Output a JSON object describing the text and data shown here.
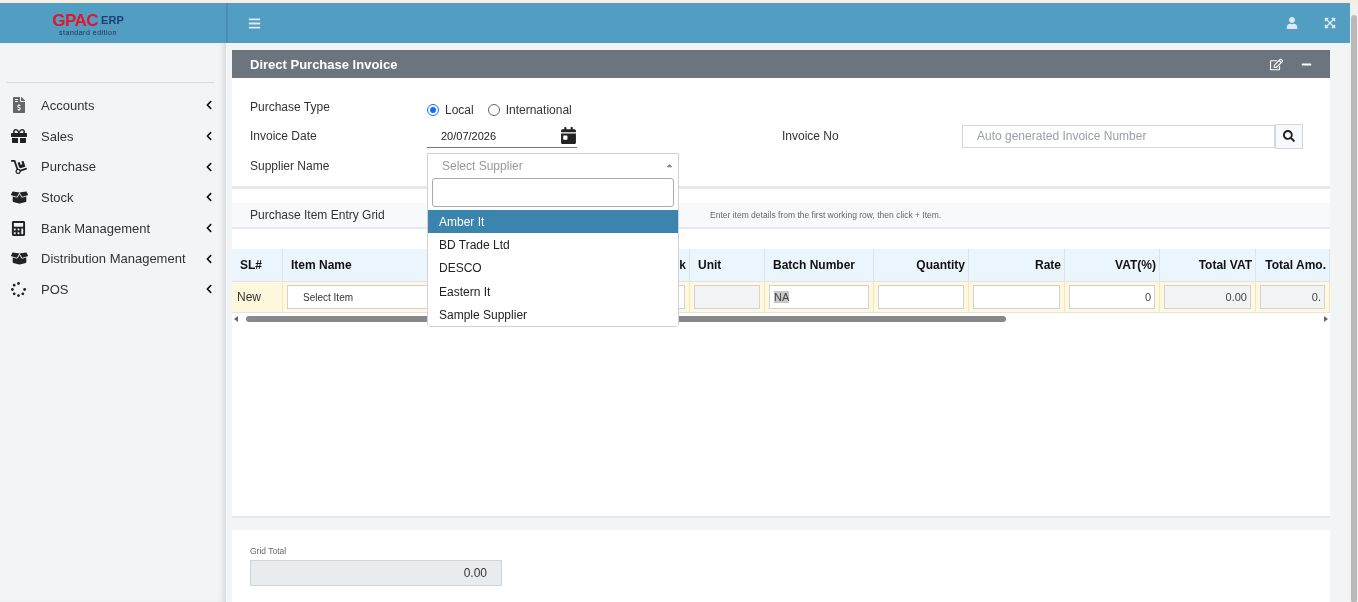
{
  "logo": {
    "brand": "GPAC",
    "suffix": "ERP",
    "edition": "standard edition"
  },
  "sidebar": {
    "items": [
      {
        "label": "Accounts",
        "kind": "accounts"
      },
      {
        "label": "Sales",
        "kind": "gift"
      },
      {
        "label": "Purchase",
        "kind": "cart"
      },
      {
        "label": "Stock",
        "kind": "box"
      },
      {
        "label": "Bank Management",
        "kind": "calculator"
      },
      {
        "label": "Distribution Management",
        "kind": "box"
      },
      {
        "label": "POS",
        "kind": "spinner"
      }
    ]
  },
  "panel": {
    "title": "Direct Purchase Invoice"
  },
  "form": {
    "purchase_type": {
      "label": "Purchase Type",
      "options": [
        {
          "label": "Local",
          "selected": true
        },
        {
          "label": "International",
          "selected": false
        }
      ]
    },
    "invoice_date": {
      "label": "Invoice Date",
      "value": "20/07/2026"
    },
    "invoice_no": {
      "label": "Invoice No",
      "placeholder": "Auto generated Invoice Number"
    },
    "supplier": {
      "label": "Supplier Name",
      "placeholder": "Select Supplier",
      "expanded": true,
      "options": [
        {
          "label": "Amber It",
          "selected": true
        },
        {
          "label": "BD Trade Ltd",
          "selected": false
        },
        {
          "label": "DESCO",
          "selected": false
        },
        {
          "label": "Eastern It",
          "selected": false
        },
        {
          "label": "Sample Supplier",
          "selected": false
        }
      ]
    }
  },
  "grid": {
    "title": "Purchase Item Entry Grid",
    "hint": "Enter item details from the first working row, then click + Item.",
    "columns": [
      {
        "label": "SL#",
        "kind": "text"
      },
      {
        "label": "Item Name",
        "kind": "text"
      },
      {
        "label": "k",
        "kind": "number"
      },
      {
        "label": "Unit",
        "kind": "text"
      },
      {
        "label": "Batch Number",
        "kind": "text"
      },
      {
        "label": "Quantity",
        "kind": "number"
      },
      {
        "label": "Rate",
        "kind": "number"
      },
      {
        "label": "VAT(%)",
        "kind": "number"
      },
      {
        "label": "Total VAT",
        "kind": "number"
      },
      {
        "label": "Total Amo.",
        "kind": "number"
      }
    ],
    "row": [
      {
        "kind": "label",
        "value": "New"
      },
      {
        "kind": "select",
        "value": "Select Item"
      },
      {
        "kind": "input"
      },
      {
        "kind": "readonly"
      },
      {
        "kind": "input",
        "value": "NA"
      },
      {
        "kind": "input"
      },
      {
        "kind": "input"
      },
      {
        "kind": "input",
        "value": "0"
      },
      {
        "kind": "readonly",
        "value": "0.00"
      },
      {
        "kind": "readonly",
        "value": "0."
      }
    ]
  },
  "grid_total": {
    "label": "Grid Total",
    "value": "0.00"
  }
}
